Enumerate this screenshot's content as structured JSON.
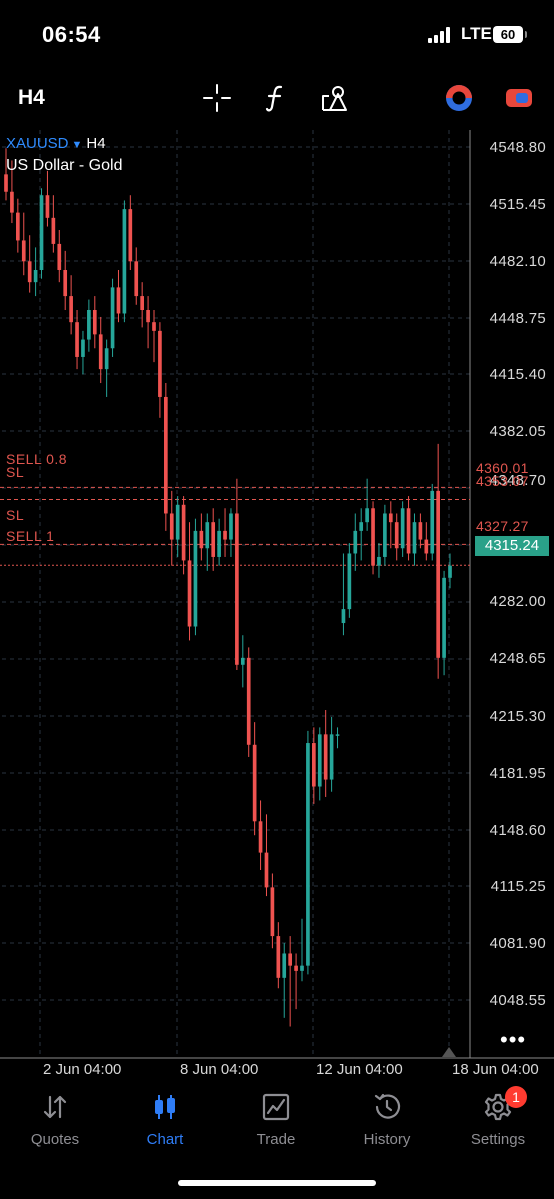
{
  "status_bar": {
    "time": "06:54",
    "network": "LTE",
    "battery": "60"
  },
  "toolbar": {
    "timeframe": "H4",
    "icons": [
      "crosshair-icon",
      "function-icon",
      "objects-icon",
      "account-icon",
      "trade-toggle-icon"
    ]
  },
  "chart": {
    "symbol": "XAUUSD",
    "timeframe": "H4",
    "description": "US Dollar - Gold",
    "price_labels": [
      "4548.80",
      "4515.45",
      "4482.10",
      "4448.75",
      "4415.40",
      "4382.05",
      "4348.70",
      "4282.00",
      "4248.65",
      "4215.30",
      "4181.95",
      "4148.60",
      "4115.25",
      "4081.90",
      "4048.55"
    ],
    "levels": [
      {
        "label": "SELL 0.8",
        "price": "4360.01",
        "value": 4360.01
      },
      {
        "label": "SL",
        "price": "4353.07",
        "value": 4353.07
      },
      {
        "label": "SL",
        "price": "4327.27",
        "value": 4327.27
      },
      {
        "label": "SELL 1",
        "price": "",
        "value": 4315.24
      }
    ],
    "current_price": "4315.24",
    "time_labels": [
      "2 Jun 04:00",
      "8 Jun 04:00",
      "12 Jun 04:00",
      "18 Jun 04:00"
    ],
    "colors": {
      "bull": "#26a69a",
      "bear": "#ef5350",
      "level": "#e0564f",
      "current": "#2aa189",
      "grid": "#2a3340"
    },
    "more_menu": "•••"
  },
  "chart_data": {
    "type": "candlestick",
    "symbol": "XAUUSD",
    "timeframe": "H4",
    "ylim": [
      4031.9,
      4565.5
    ],
    "candles": [
      [
        4540,
        4555,
        4525,
        4530
      ],
      [
        4530,
        4548,
        4512,
        4518
      ],
      [
        4518,
        4526,
        4495,
        4502
      ],
      [
        4502,
        4518,
        4482,
        4490
      ],
      [
        4490,
        4505,
        4472,
        4478
      ],
      [
        4478,
        4498,
        4470,
        4485
      ],
      [
        4485,
        4532,
        4480,
        4528
      ],
      [
        4528,
        4542,
        4510,
        4515
      ],
      [
        4515,
        4528,
        4495,
        4500
      ],
      [
        4500,
        4508,
        4478,
        4485
      ],
      [
        4485,
        4496,
        4462,
        4470
      ],
      [
        4470,
        4482,
        4448,
        4455
      ],
      [
        4455,
        4462,
        4428,
        4435
      ],
      [
        4435,
        4450,
        4425,
        4445
      ],
      [
        4445,
        4468,
        4438,
        4462
      ],
      [
        4462,
        4470,
        4440,
        4448
      ],
      [
        4448,
        4458,
        4420,
        4428
      ],
      [
        4428,
        4445,
        4412,
        4440
      ],
      [
        4440,
        4480,
        4435,
        4475
      ],
      [
        4475,
        4485,
        4455,
        4460
      ],
      [
        4460,
        4525,
        4455,
        4520
      ],
      [
        4520,
        4528,
        4485,
        4490
      ],
      [
        4490,
        4498,
        4465,
        4470
      ],
      [
        4470,
        4478,
        4452,
        4462
      ],
      [
        4462,
        4470,
        4440,
        4455
      ],
      [
        4455,
        4462,
        4432,
        4450
      ],
      [
        4450,
        4455,
        4400,
        4412
      ],
      [
        4412,
        4420,
        4335,
        4345
      ],
      [
        4345,
        4358,
        4315,
        4330
      ],
      [
        4330,
        4355,
        4320,
        4350
      ],
      [
        4350,
        4355,
        4310,
        4318
      ],
      [
        4318,
        4340,
        4272,
        4280
      ],
      [
        4280,
        4342,
        4275,
        4335
      ],
      [
        4335,
        4345,
        4318,
        4325
      ],
      [
        4325,
        4345,
        4312,
        4340
      ],
      [
        4340,
        4348,
        4312,
        4320
      ],
      [
        4320,
        4342,
        4315,
        4335
      ],
      [
        4335,
        4348,
        4320,
        4330
      ],
      [
        4330,
        4348,
        4320,
        4345
      ],
      [
        4345,
        4365,
        4255,
        4258
      ],
      [
        4258,
        4275,
        4245,
        4262
      ],
      [
        4262,
        4268,
        4205,
        4212
      ],
      [
        4212,
        4225,
        4160,
        4168
      ],
      [
        4168,
        4180,
        4140,
        4150
      ],
      [
        4150,
        4172,
        4125,
        4130
      ],
      [
        4130,
        4138,
        4095,
        4102
      ],
      [
        4102,
        4110,
        4072,
        4078
      ],
      [
        4078,
        4098,
        4055,
        4092
      ],
      [
        4092,
        4102,
        4050,
        4085
      ],
      [
        4085,
        4092,
        4060,
        4082
      ],
      [
        4082,
        4112,
        4076,
        4085
      ],
      [
        4085,
        4220,
        4080,
        4213
      ],
      [
        4213,
        4222,
        4178,
        4188
      ],
      [
        4188,
        4222,
        4180,
        4218
      ],
      [
        4218,
        4232,
        4182,
        4192
      ],
      [
        4192,
        4228,
        4185,
        4218
      ],
      [
        4218,
        4222,
        4210,
        4218
      ],
      [
        4282,
        4322,
        4275,
        4290
      ],
      [
        4290,
        4328,
        4285,
        4322
      ],
      [
        4322,
        4345,
        4312,
        4335
      ],
      [
        4335,
        4348,
        4318,
        4340
      ],
      [
        4340,
        4365,
        4335,
        4348
      ],
      [
        4348,
        4352,
        4310,
        4315
      ],
      [
        4315,
        4328,
        4308,
        4320
      ],
      [
        4320,
        4350,
        4315,
        4345
      ],
      [
        4345,
        4352,
        4325,
        4340
      ],
      [
        4340,
        4345,
        4318,
        4325
      ],
      [
        4325,
        4352,
        4320,
        4348
      ],
      [
        4348,
        4355,
        4318,
        4322
      ],
      [
        4322,
        4345,
        4315,
        4340
      ],
      [
        4340,
        4345,
        4325,
        4330
      ],
      [
        4330,
        4340,
        4318,
        4322
      ],
      [
        4322,
        4362,
        4318,
        4358
      ],
      [
        4358,
        4385,
        4250,
        4262
      ],
      [
        4262,
        4312,
        4252,
        4308
      ],
      [
        4308,
        4322,
        4302,
        4315
      ]
    ]
  },
  "tabs": [
    {
      "label": "Quotes",
      "icon": "arrows-up-down-icon"
    },
    {
      "label": "Chart",
      "icon": "candlesticks-icon",
      "active": true
    },
    {
      "label": "Trade",
      "icon": "trade-chart-icon"
    },
    {
      "label": "History",
      "icon": "history-clock-icon"
    },
    {
      "label": "Settings",
      "icon": "gear-icon",
      "badge": "1"
    }
  ]
}
